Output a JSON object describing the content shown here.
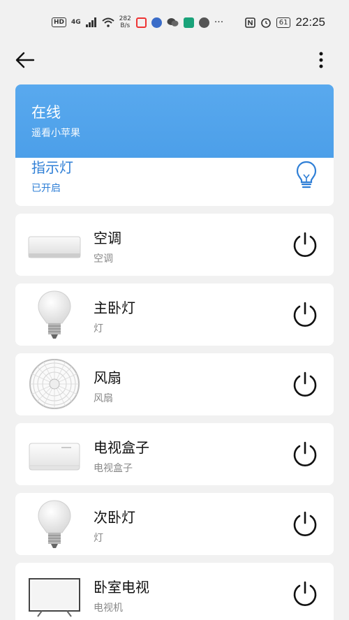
{
  "status_bar": {
    "hd": "HD",
    "net_gen": "4G",
    "speed_value": "282",
    "speed_unit": "B/s",
    "battery": "61",
    "time": "22:25",
    "dots": "···"
  },
  "header": {
    "online_title": "在线",
    "online_subtitle": "遥看小苹果"
  },
  "indicator": {
    "title": "指示灯",
    "status": "已开启"
  },
  "devices": [
    {
      "name": "空调",
      "type": "空调",
      "icon": "air-conditioner"
    },
    {
      "name": "主卧灯",
      "type": "灯",
      "icon": "light-bulb"
    },
    {
      "name": "风扇",
      "type": "风扇",
      "icon": "fan"
    },
    {
      "name": "电视盒子",
      "type": "电视盒子",
      "icon": "tv-box"
    },
    {
      "name": "次卧灯",
      "type": "灯",
      "icon": "light-bulb"
    },
    {
      "name": "卧室电视",
      "type": "电视机",
      "icon": "television"
    }
  ],
  "colors": {
    "accent": "#4c9fe9",
    "indicator_text": "#2f7fd6",
    "background": "#f1f1f1"
  }
}
